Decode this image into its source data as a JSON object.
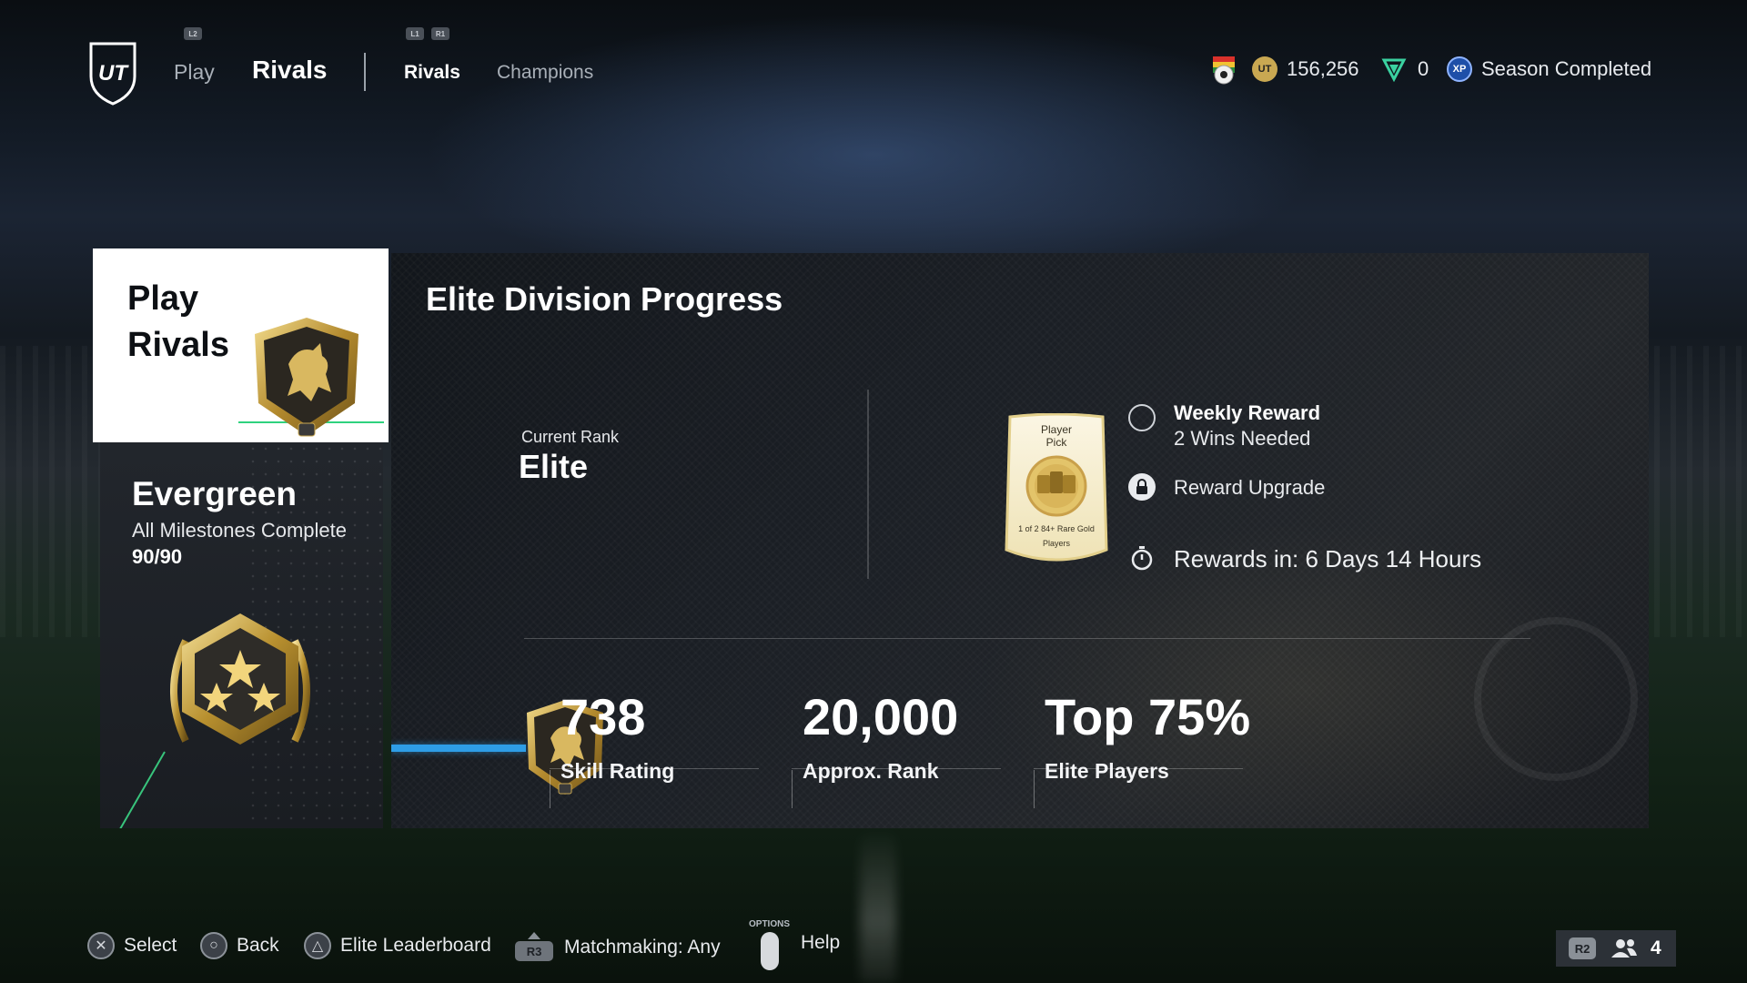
{
  "topbar": {
    "logo_text": "UT",
    "bumper_left": "L2",
    "nav": [
      {
        "label": "Play"
      },
      {
        "label": "Rivals"
      }
    ],
    "sub_bumpers": [
      "L1",
      "R1"
    ],
    "sub_nav": [
      {
        "label": "Rivals"
      },
      {
        "label": "Champions"
      }
    ],
    "coins": "156,256",
    "points": "0",
    "xp_icon": "XP",
    "season_status": "Season Completed"
  },
  "play_card": {
    "title_line1": "Play",
    "title_line2": "Rivals"
  },
  "milestone": {
    "name": "Evergreen",
    "subtitle": "All Milestones Complete",
    "count": "90/90"
  },
  "main": {
    "title": "Elite Division Progress",
    "rank_label": "Current Rank",
    "rank_value": "Elite",
    "pick_card": {
      "line1": "Player",
      "line2": "Pick",
      "caption_line1": "1 of 2 84+ Rare Gold",
      "caption_line2": "Players"
    },
    "rewards": {
      "weekly_title": "Weekly Reward",
      "weekly_sub": "2 Wins Needed",
      "upgrade": "Reward Upgrade",
      "timer": "Rewards in: 6 Days 14 Hours"
    },
    "progress_fraction": 0.107,
    "stats": [
      {
        "value": "738",
        "label": "Skill Rating"
      },
      {
        "value": "20,000",
        "label": "Approx. Rank"
      },
      {
        "value": "Top 75%",
        "label": "Elite Players"
      }
    ]
  },
  "footer": {
    "select": "Select",
    "back": "Back",
    "leaderboard": "Elite Leaderboard",
    "r3": "R3",
    "matchmaking": "Matchmaking: Any",
    "options": "OPTIONS",
    "help": "Help",
    "r2": "R2",
    "friends_count": "4"
  },
  "colors": {
    "accent_blue": "#2e9de6",
    "accent_green": "#2fd27e",
    "gold": "#c9a852"
  }
}
